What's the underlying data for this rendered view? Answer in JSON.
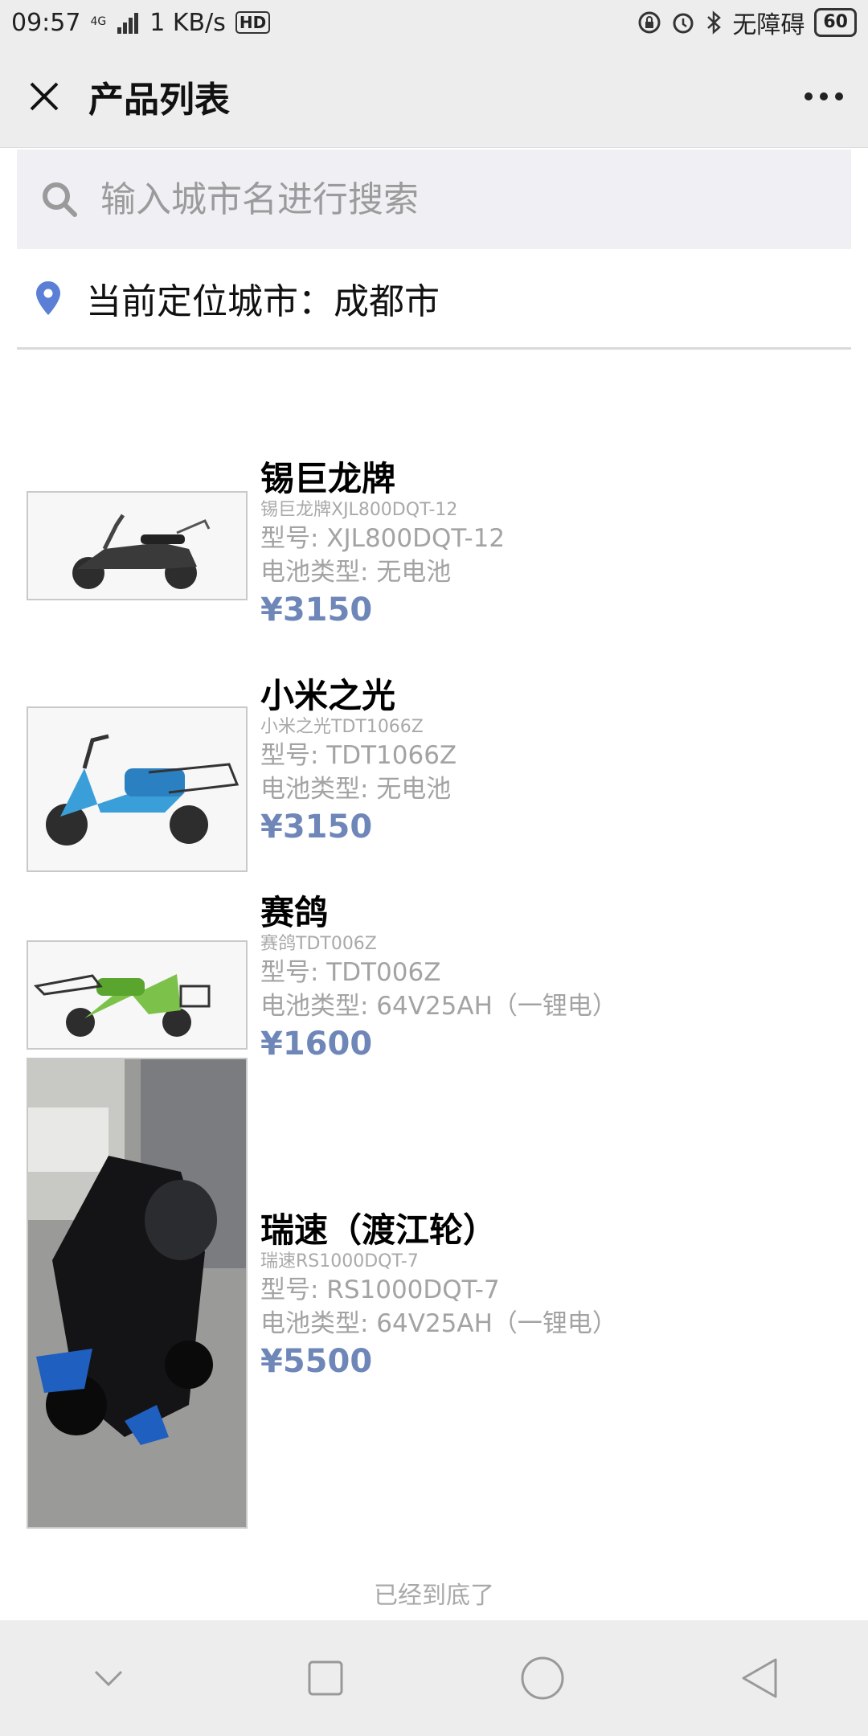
{
  "status_bar": {
    "time": "09:57",
    "network": "4G",
    "speed": "1 KB/s",
    "hd": "HD",
    "accessibility": "无障碍",
    "battery": "60"
  },
  "nav": {
    "title": "产品列表",
    "close_icon": "close-icon",
    "more_icon": "more-icon"
  },
  "search": {
    "placeholder": "输入城市名进行搜索",
    "value": ""
  },
  "location": {
    "label": "当前定位城市：成都市"
  },
  "products": [
    {
      "name": "锡巨龙牌",
      "subtitle": "锡巨龙牌XJL800DQT-12",
      "model": "型号: XJL800DQT-12",
      "battery": "电池类型: 无电池",
      "price": "¥3150"
    },
    {
      "name": "小米之光",
      "subtitle": "小米之光TDT1066Z",
      "model": "型号: TDT1066Z",
      "battery": "电池类型: 无电池",
      "price": "¥3150"
    },
    {
      "name": "赛鸽",
      "subtitle": "赛鸽TDT006Z",
      "model": "型号: TDT006Z",
      "battery": "电池类型: 64V25AH（一锂电）",
      "price": "¥1600"
    },
    {
      "name": "瑞速（渡江轮）",
      "subtitle": "瑞速RS1000DQT-7",
      "model": "型号: RS1000DQT-7",
      "battery": "电池类型: 64V25AH（一锂电）",
      "price": "¥5500"
    }
  ],
  "footer": {
    "end_text": "已经到底了"
  },
  "colors": {
    "accent": "#6f86b8",
    "location_pin": "#5b7fd6",
    "background": "#ededed"
  }
}
